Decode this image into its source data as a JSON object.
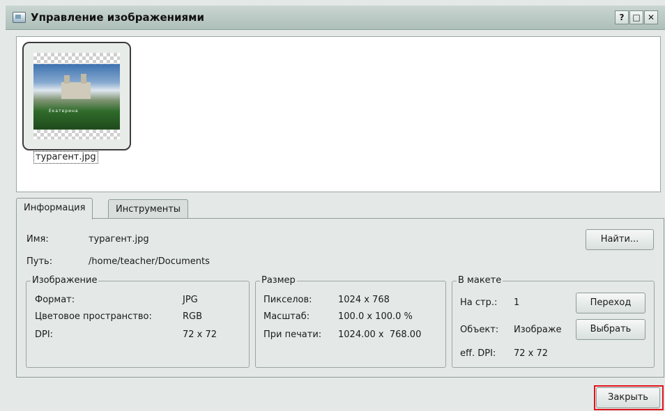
{
  "window": {
    "title": "Управление изображениями",
    "icon": "image-manager-icon",
    "controls": {
      "help": "?",
      "maximize": "□",
      "close": "✕"
    }
  },
  "preview": {
    "thumbnail_caption": "турагент.jpg",
    "thumbnail_text": "Екатерина"
  },
  "tabs": [
    {
      "label": "Информация",
      "active": true
    },
    {
      "label": "Инструменты",
      "active": false
    }
  ],
  "info": {
    "name_label": "Имя:",
    "name_value": "турагент.jpg",
    "path_label": "Путь:",
    "path_value": "/home/teacher/Documents",
    "find_button": "Найти..."
  },
  "image_group": {
    "title": "Изображение",
    "format_label": "Формат:",
    "format_value": "JPG",
    "colorspace_label": "Цветовое пространство:",
    "colorspace_value": "RGB",
    "dpi_label": "DPI:",
    "dpi_value": "72 x 72"
  },
  "size_group": {
    "title": "Размер",
    "pixels_label": "Пикселов:",
    "pixels_value": "1024 x 768",
    "scale_label": "Масштаб:",
    "scale_value": "100.0 x 100.0 %",
    "print_label": "При печати:",
    "print_value": "1024.00 x  768.00"
  },
  "layout_group": {
    "title": "В макете",
    "page_label": "На стр.:",
    "page_value": "1",
    "goto_button": "Переход",
    "object_label": "Объект:",
    "object_value": "Изображе",
    "select_button": "Выбрать",
    "effdpi_label": "eff. DPI:",
    "effdpi_value": "72 x 72"
  },
  "footer": {
    "close_button": "Закрыть",
    "highlight_color": "#e0141c"
  }
}
